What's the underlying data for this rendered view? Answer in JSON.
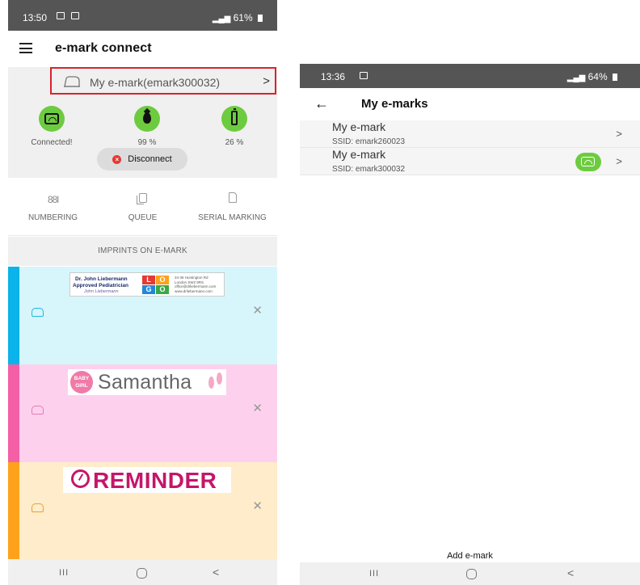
{
  "left": {
    "status": {
      "time": "13:50",
      "battery": "61%"
    },
    "title": "e-mark connect",
    "device_selector": {
      "label": "My e-mark(emark300032)",
      "chevron": ">"
    },
    "stats": [
      {
        "icon": "device-icon",
        "value": "Connected!"
      },
      {
        "icon": "ink-drop-icon",
        "value": "99 %"
      },
      {
        "icon": "battery-icon",
        "value": "26 %"
      }
    ],
    "disconnect_label": "Disconnect",
    "modes": [
      {
        "icon": "numbering-icon",
        "label": "NUMBERING"
      },
      {
        "icon": "queue-icon",
        "label": "QUEUE"
      },
      {
        "icon": "serial-marking-icon",
        "label": "SERIAL MARKING"
      }
    ],
    "imprints_header": "IMPRINTS ON E-MARK",
    "imprints": [
      {
        "stripe_color": "#0ab3ea",
        "bg_color": "#d7f6fb",
        "icon_color": "#1fb4e6",
        "stamp": {
          "line1": "Dr. John Liebermann",
          "line2": "Approved Pediatrician",
          "signature": "John Liebermann",
          "logo": [
            "L",
            "O",
            "G",
            "O"
          ],
          "address": [
            "34-36 Huntington Rd",
            "London SW2 9RS",
            "office@drliebermann.com",
            "www.drliebermann.com"
          ]
        }
      },
      {
        "stripe_color": "#f45fa6",
        "bg_color": "#fdd1ed",
        "icon_color": "#e57ab7",
        "stamp": {
          "badge_top": "BABY",
          "badge_bottom": "GIRL",
          "name": "Samantha"
        }
      },
      {
        "stripe_color": "#ffa21b",
        "bg_color": "#ffeccb",
        "icon_color": "#e3a427",
        "stamp": {
          "word": "REMINDER"
        }
      }
    ],
    "nav": {
      "recent": "III",
      "home": "O",
      "back": "<"
    }
  },
  "right": {
    "status": {
      "time": "13:36",
      "battery": "64%"
    },
    "title": "My e-marks",
    "back_arrow": "←",
    "devices": [
      {
        "name": "My e-mark",
        "ssid": "SSID: emark260023",
        "connected": false
      },
      {
        "name": "My e-mark",
        "ssid": "SSID: emark300032",
        "connected": true
      }
    ],
    "add_label": "Add e-mark",
    "nav": {
      "recent": "III",
      "home": "O",
      "back": "<"
    }
  },
  "colors": {
    "accent_green": "#6dcb3f",
    "highlight_red": "#d9232d",
    "logo_red": "#e53935",
    "logo_orange": "#ffa21b",
    "logo_blue": "#1f88d8",
    "logo_green": "#39a845",
    "reminder_magenta": "#c4166a"
  }
}
